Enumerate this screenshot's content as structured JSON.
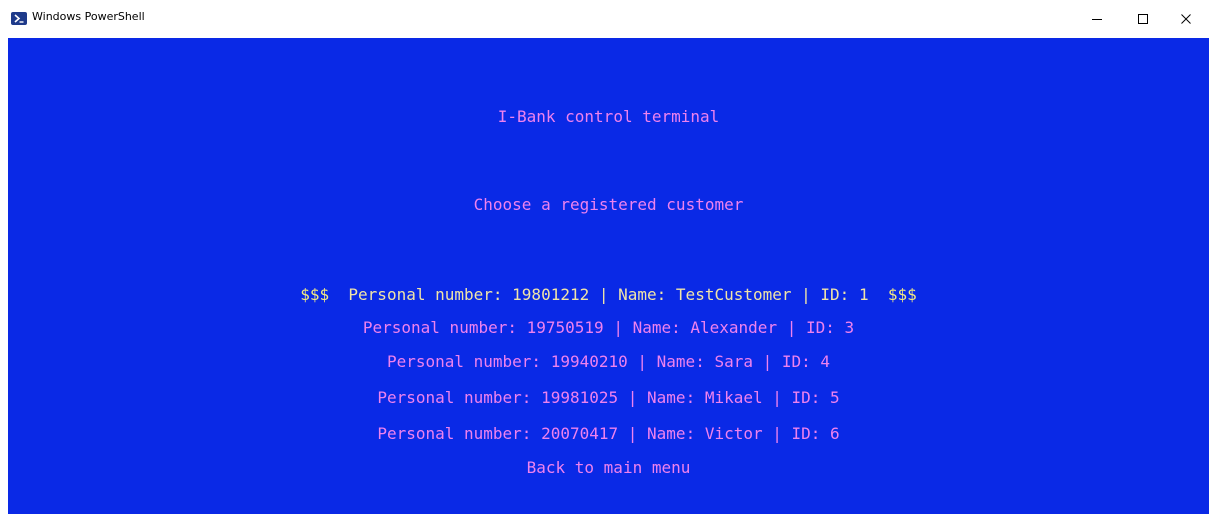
{
  "window": {
    "title": "Windows PowerShell"
  },
  "terminal": {
    "header": "I-Bank control terminal",
    "subheader": "Choose a registered customer",
    "selected_marker": "$$$",
    "customers": [
      "Personal number: 19801212 | Name: TestCustomer | ID: 1",
      "Personal number: 19750519 | Name: Alexander | ID: 3",
      "Personal number: 19940210 | Name: Sara | ID: 4",
      "Personal number: 19981025 | Name: Mikael | ID: 5",
      "Personal number: 20070417 | Name: Victor | ID: 6"
    ],
    "back_label": "Back to main menu"
  },
  "colors": {
    "terminal_bg": "#0a29e6",
    "menu_text": "#ee82ee",
    "selected_text": "#f0e4a8"
  },
  "icons": {
    "app": "powershell-icon",
    "minimize": "minimize-icon",
    "maximize": "maximize-icon",
    "close": "close-icon"
  }
}
